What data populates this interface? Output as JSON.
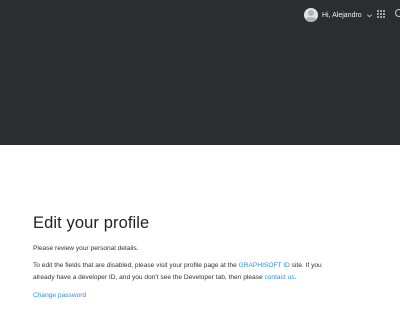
{
  "header": {
    "greeting": "Hi, Alejandro"
  },
  "icons": {
    "avatar": "user-avatar-icon",
    "menu_toggle": "chevron-down-icon",
    "apps": "apps-grid-icon",
    "search": "search-icon"
  },
  "colors": {
    "header_bg": "#2c2d30",
    "link": "#2f8fd9"
  },
  "main": {
    "title": "Edit your profile",
    "intro": "Please review your personal details.",
    "info_part1": "To edit the fields that are disabled, please visit your profile page at the ",
    "graphisoft_link": "GRAPHISOFT ID",
    "info_part2": " site. If you already have a developer ID, and you don't see the Developer tab, then please ",
    "contact_link": "contact us",
    "info_part3": ".",
    "change_password": "Change password"
  }
}
